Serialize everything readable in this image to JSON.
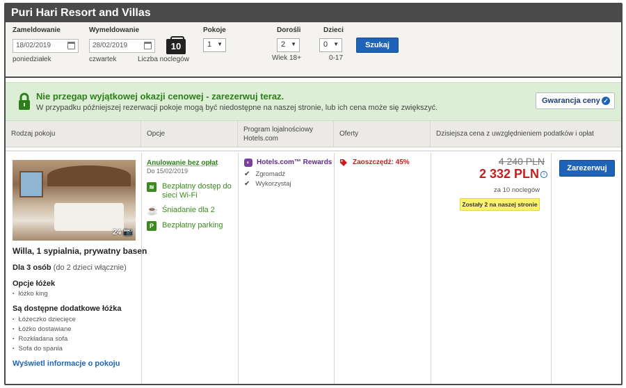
{
  "hotel": {
    "title": "Puri Hari Resort and Villas"
  },
  "search": {
    "checkin_label": "Zameldowanie",
    "checkin_value": "18/02/2019",
    "checkin_day": "poniedziałek",
    "checkout_label": "Wymeldowanie",
    "checkout_value": "28/02/2019",
    "checkout_day": "czwartek",
    "nights_value": "10",
    "nights_label": "Liczba noclegów",
    "rooms_label": "Pokoje",
    "rooms_value": "1",
    "adults_label": "Dorośli",
    "adults_value": "2",
    "adults_note": "Wiek 18+",
    "children_label": "Dzieci",
    "children_value": "0",
    "children_note": "0-17",
    "search_button": "Szukaj"
  },
  "promo": {
    "title": "Nie przegap wyjątkowej okazji cenowej - zarezerwuj teraz.",
    "text": "W przypadku późniejszej rezerwacji pokoje mogą być niedostępne na naszej stronie, lub ich cena może się zwiększyć.",
    "guarantee_button": "Gwarancja ceny",
    "accent": "#2d7d1a"
  },
  "table": {
    "headers": [
      "Rodzaj pokoju",
      "Opcje",
      "Program lojalnościowy Hotels.com",
      "Oferty",
      "Dzisiejsza cena z uwzględnieniem podatków i opłat"
    ]
  },
  "room": {
    "photo_count": "24",
    "name": "Willa, 1 sypialnia, prywatny basen",
    "occupancy_bold": "Dla 3 osób",
    "occupancy_rest": " (do 2 dzieci włącznie)",
    "bed_options_title": "Opcje łóżek",
    "bed_options": [
      "łóżko king"
    ],
    "extra_beds_title": "Są dostępne dodatkowe łóżka",
    "extra_beds": [
      "Łóżeczko dziecięce",
      "Łóżko dostawiane",
      "Rozkładana sofa",
      "Sofa do spania"
    ],
    "info_link": "Wyświetl informacje o pokoju"
  },
  "options": {
    "cancel_title": "Anulowanie bez opłat",
    "cancel_date": "Do 15/02/2019",
    "amenities": [
      {
        "icon": "wifi-icon",
        "label": "Bezpłatny dostęp do sieci Wi-Fi"
      },
      {
        "icon": "coffee-icon",
        "label": "Śniadanie dla 2"
      },
      {
        "icon": "parking-icon",
        "label": "Bezpłatny parking"
      }
    ]
  },
  "loyalty": {
    "title": "Hotels.com™ Rewards",
    "items": [
      "Zgromadź",
      "Wykorzystaj"
    ]
  },
  "offers": {
    "text": "Zaoszczędź: 45%"
  },
  "price": {
    "old": "4 240 PLN",
    "new": "2 332 PLN",
    "per_nights": "za 10 noclegów",
    "availability": "Zostały 2 na naszej stronie",
    "book_button": "Zarezerwuj",
    "price_color": "#c41f1f"
  }
}
